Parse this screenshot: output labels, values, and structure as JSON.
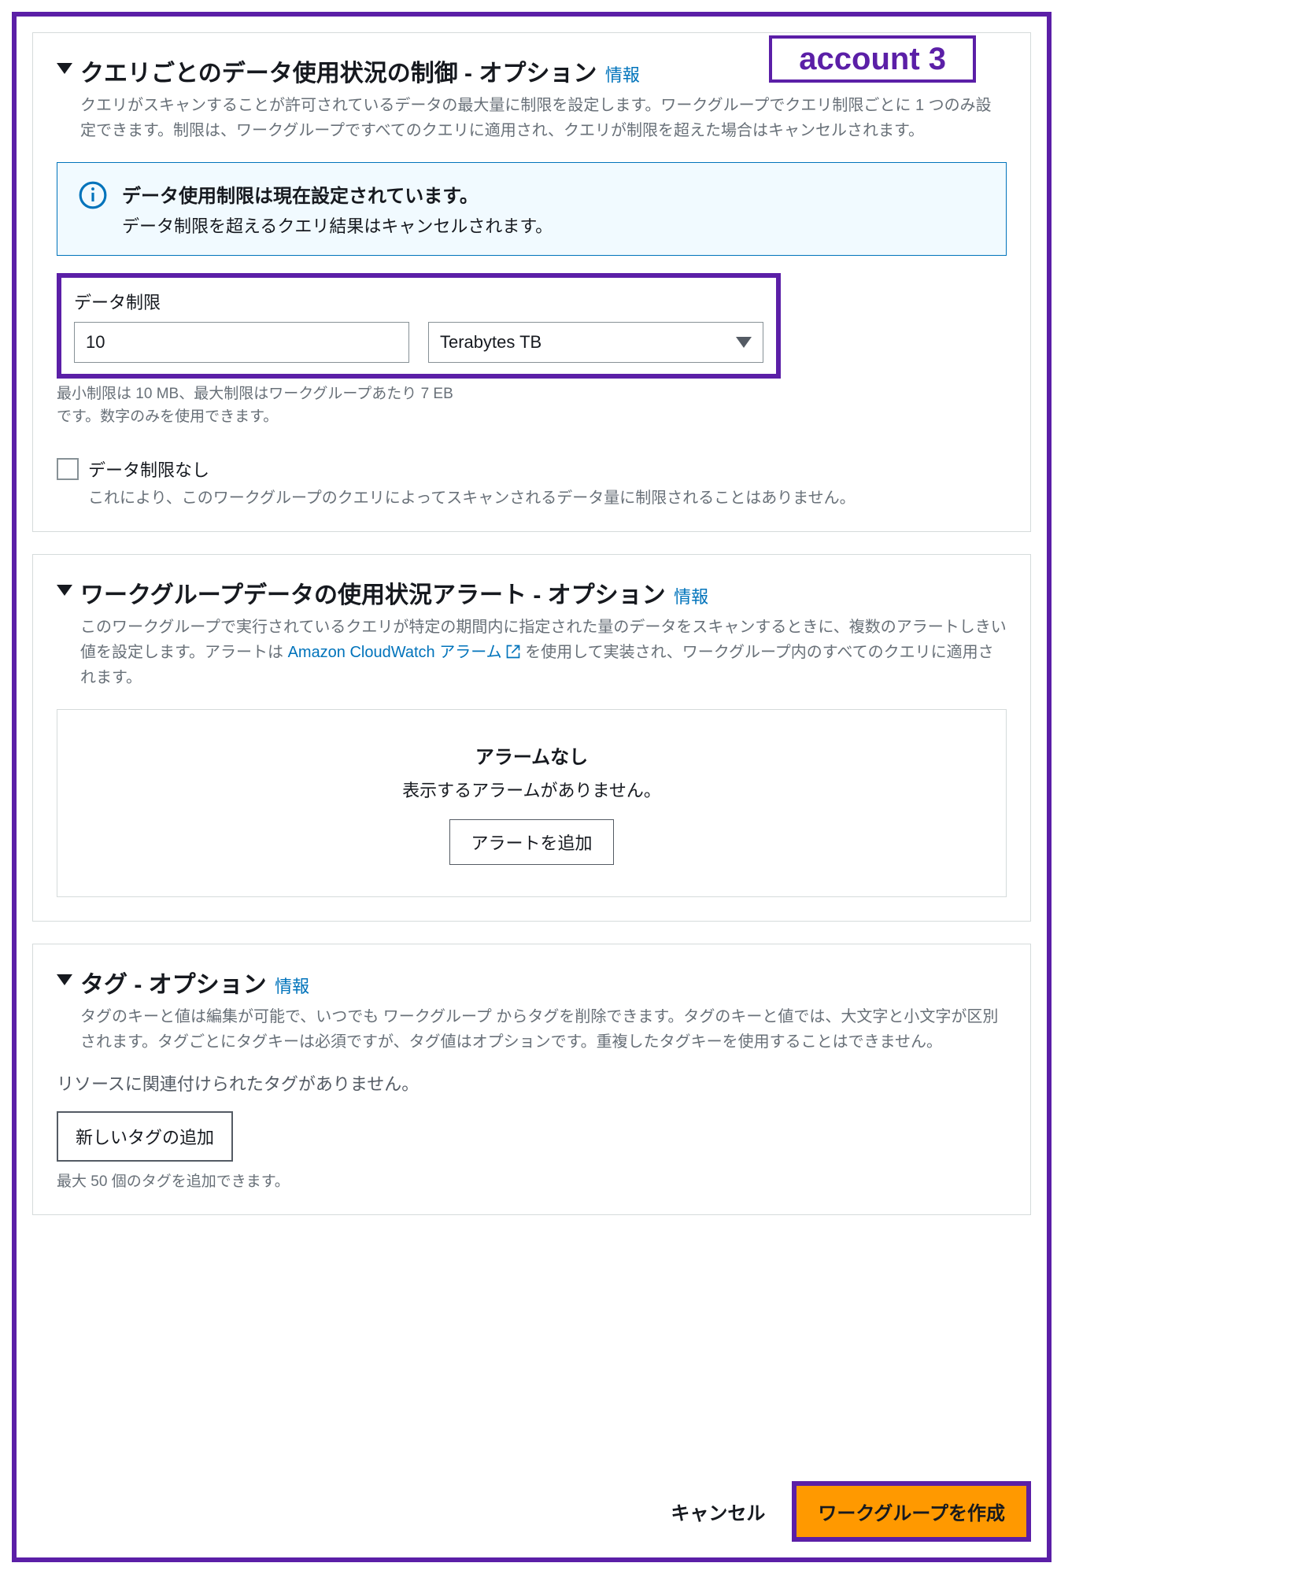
{
  "annotation": {
    "account_label": "account 3"
  },
  "sections": {
    "per_query": {
      "title": "クエリごとのデータ使用状況の制御 - オプション",
      "info": "情報",
      "desc": "クエリがスキャンすることが許可されているデータの最大量に制限を設定します。ワークグループでクエリ制限ごとに 1 つのみ設定できます。制限は、ワークグループですべてのクエリに適用され、クエリが制限を超えた場合はキャンセルされます。",
      "banner_title": "データ使用制限は現在設定されています。",
      "banner_sub": "データ制限を超えるクエリ結果はキャンセルされます。",
      "field_label": "データ制限",
      "value": "10",
      "unit": "Terabytes TB",
      "hint": "最小制限は 10 MB、最大制限はワークグループあたり 7 EB です。数字のみを使用できます。",
      "chk_label": "データ制限なし",
      "chk_desc": "これにより、このワークグループのクエリによってスキャンされるデータ量に制限されることはありません。"
    },
    "workgroup_alerts": {
      "title": "ワークグループデータの使用状況アラート - オプション",
      "info": "情報",
      "desc_pre": "このワークグループで実行されているクエリが特定の期間内に指定された量のデータをスキャンするときに、複数のアラートしきい値を設定します。アラートは ",
      "desc_link": "Amazon CloudWatch アラーム",
      "desc_post": " を使用して実装され、ワークグループ内のすべてのクエリに適用されます。",
      "empty_title": "アラームなし",
      "empty_sub": "表示するアラームがありません。",
      "add_btn": "アラートを追加"
    },
    "tags": {
      "title": "タグ - オプション",
      "info": "情報",
      "desc": "タグのキーと値は編集が可能で、いつでも ワークグループ からタグを削除できます。タグのキーと値では、大文字と小文字が区別されます。タグごとにタグキーは必須ですが、タグ値はオプションです。重複したタグキーを使用することはできません。",
      "empty": "リソースに関連付けられたタグがありません。",
      "add_btn": "新しいタグの追加",
      "hint": "最大 50 個のタグを追加できます。"
    }
  },
  "footer": {
    "cancel": "キャンセル",
    "create": "ワークグループを作成"
  }
}
